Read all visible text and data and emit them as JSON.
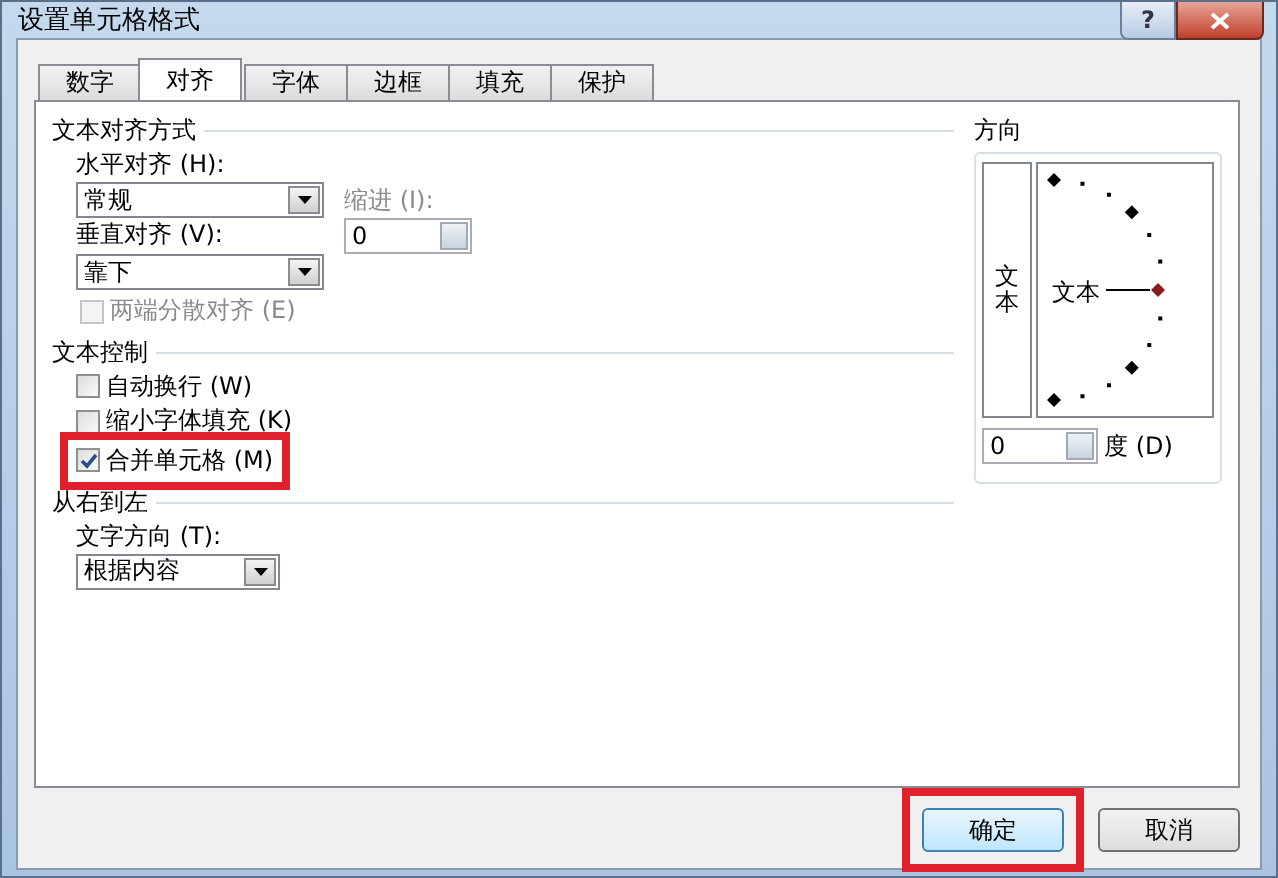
{
  "window": {
    "title": "设置单元格格式",
    "help": "?"
  },
  "tabs": [
    {
      "label": "数字",
      "selected": false
    },
    {
      "label": "对齐",
      "selected": true
    },
    {
      "label": "字体",
      "selected": false
    },
    {
      "label": "边框",
      "selected": false
    },
    {
      "label": "填充",
      "selected": false
    },
    {
      "label": "保护",
      "selected": false
    }
  ],
  "text_alignment": {
    "title": "文本对齐方式",
    "horizontal_label": "水平对齐 (H):",
    "horizontal_value": "常规",
    "indent_label": "缩进 (I):",
    "indent_value": "0",
    "vertical_label": "垂直对齐 (V):",
    "vertical_value": "靠下",
    "distributed": {
      "label": "两端分散对齐 (E)",
      "checked": false,
      "disabled": true
    }
  },
  "text_control": {
    "title": "文本控制",
    "options": [
      {
        "label": "自动换行 (W)",
        "checked": false,
        "highlighted": false
      },
      {
        "label": "缩小字体填充 (K)",
        "checked": false,
        "highlighted": false
      },
      {
        "label": "合并单元格 (M)",
        "checked": true,
        "highlighted": true
      }
    ]
  },
  "right_to_left": {
    "title": "从右到左",
    "direction_label": "文字方向 (T):",
    "direction_value": "根据内容"
  },
  "orientation": {
    "title": "方向",
    "vertical_text": "文本",
    "dial_text": "文本",
    "degrees_value": "0",
    "degrees_label": "度 (D)"
  },
  "buttons": [
    {
      "label": "确定",
      "highlighted": true
    },
    {
      "label": "取消",
      "highlighted": false
    }
  ]
}
